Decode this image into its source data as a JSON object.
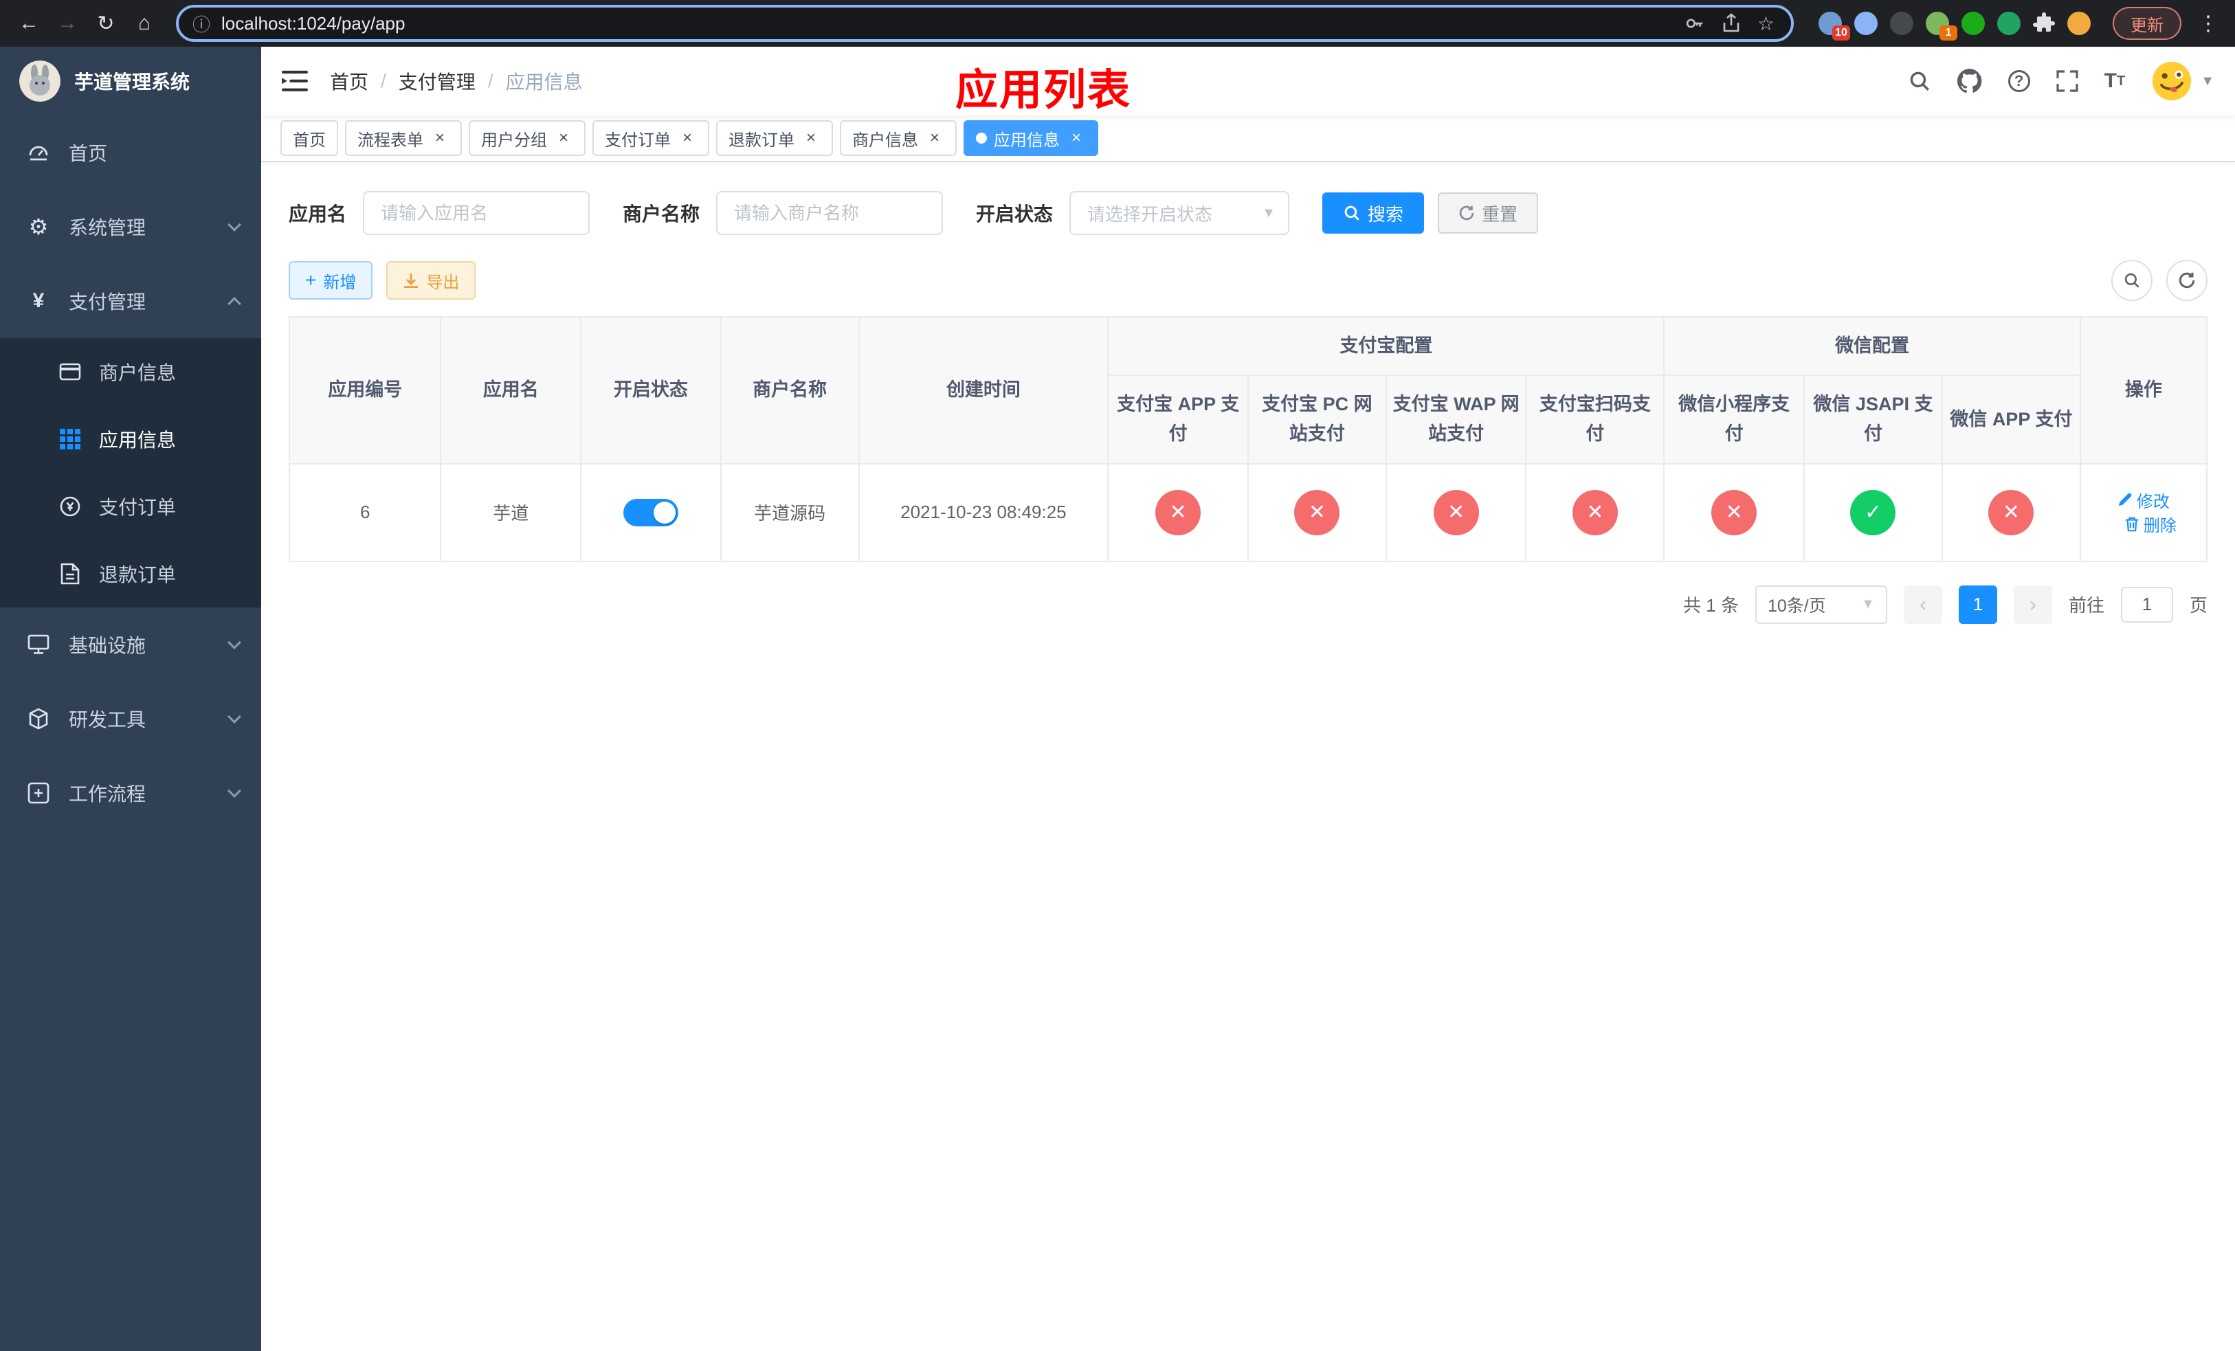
{
  "colors": {
    "primary": "#1890ff",
    "success": "#13ce66",
    "danger": "#f56c6c",
    "warning": "#e6a23c",
    "annotation": "#fe0000",
    "sidebar_bg": "#304156",
    "submenu_bg": "#1f2d3d"
  },
  "browser": {
    "url": "localhost:1024/pay/app",
    "update_label": "更新",
    "extensions": [
      {
        "name": "extension-grid",
        "color": "#6f9bd1",
        "badge": "10",
        "badge_color": "#e33a2f"
      },
      {
        "name": "extension-drop",
        "color": "#8ab4f8",
        "badge": "",
        "badge_color": ""
      },
      {
        "name": "extension-dark",
        "color": "#45484d",
        "badge": "",
        "badge_color": ""
      },
      {
        "name": "extension-profile",
        "color": "#7cb85c",
        "badge": "1",
        "badge_color": "#e8710a"
      },
      {
        "name": "extension-check",
        "color": "#1aad19",
        "badge": "",
        "badge_color": ""
      },
      {
        "name": "extension-notes",
        "color": "#20a464",
        "badge": "",
        "badge_color": ""
      },
      {
        "name": "extension-face",
        "color": "#f3aa3c",
        "badge": "",
        "badge_color": ""
      }
    ]
  },
  "sidebar": {
    "title": "芋道管理系统",
    "menu": {
      "home": "首页",
      "system": "系统管理",
      "payment": "支付管理",
      "payment_children": {
        "merchant": "商户信息",
        "app": "应用信息",
        "order": "支付订单",
        "refund": "退款订单"
      },
      "infra": "基础设施",
      "devtools": "研发工具",
      "workflow": "工作流程"
    }
  },
  "header": {
    "breadcrumb": [
      "首页",
      "支付管理",
      "应用信息"
    ],
    "separator": "/",
    "annotation": "应用列表"
  },
  "tabs": [
    {
      "label": "首页",
      "closable": false,
      "active": false
    },
    {
      "label": "流程表单",
      "closable": true,
      "active": false
    },
    {
      "label": "用户分组",
      "closable": true,
      "active": false
    },
    {
      "label": "支付订单",
      "closable": true,
      "active": false
    },
    {
      "label": "退款订单",
      "closable": true,
      "active": false
    },
    {
      "label": "商户信息",
      "closable": true,
      "active": false
    },
    {
      "label": "应用信息",
      "closable": true,
      "active": true
    }
  ],
  "filters": {
    "app_name": {
      "label": "应用名",
      "placeholder": "请输入应用名",
      "value": ""
    },
    "merchant_name": {
      "label": "商户名称",
      "placeholder": "请输入商户名称",
      "value": ""
    },
    "status": {
      "label": "开启状态",
      "placeholder": "请选择开启状态",
      "value": ""
    },
    "search_label": "搜索",
    "reset_label": "重置"
  },
  "toolbar": {
    "add_label": "新增",
    "export_label": "导出"
  },
  "table": {
    "columns": {
      "id": "应用编号",
      "name": "应用名",
      "status": "开启状态",
      "merchant": "商户名称",
      "created": "创建时间",
      "alipay_group": "支付宝配置",
      "alipay": [
        "支付宝 APP 支付",
        "支付宝 PC 网站支付",
        "支付宝 WAP 网站支付",
        "支付宝扫码支付"
      ],
      "wechat_group": "微信配置",
      "wechat": [
        "微信小程序支付",
        "微信 JSAPI 支付",
        "微信 APP 支付"
      ],
      "actions": "操作"
    },
    "rows": [
      {
        "id": "6",
        "name": "芋道",
        "status_on": true,
        "merchant": "芋道源码",
        "created": "2021-10-23 08:49:25",
        "configs": [
          "no",
          "no",
          "no",
          "no",
          "no",
          "yes",
          "no"
        ],
        "edit_label": "修改",
        "delete_label": "删除"
      }
    ]
  },
  "pagination": {
    "total": "共 1 条",
    "page_size": "10条/页",
    "current_page": "1",
    "goto_label": "前往",
    "goto_value": "1",
    "page_unit": "页"
  }
}
